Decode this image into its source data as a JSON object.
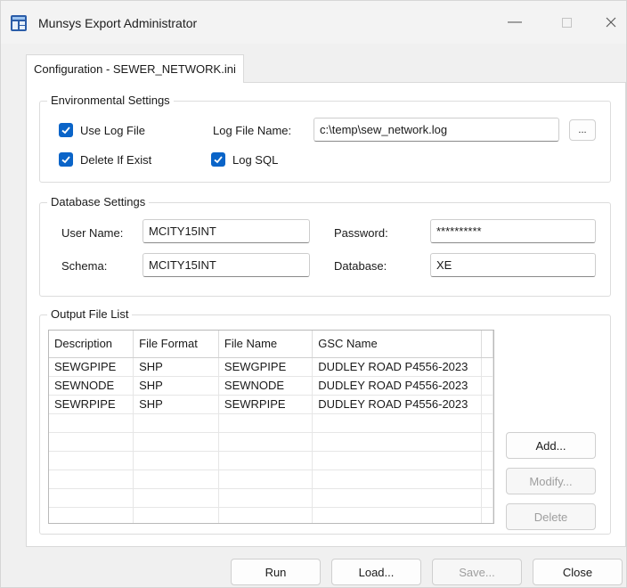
{
  "window": {
    "title": "Munsys Export Administrator"
  },
  "tab": {
    "label": "Configuration - SEWER_NETWORK.ini"
  },
  "environmental": {
    "legend": "Environmental Settings",
    "use_log_file": {
      "label": "Use Log File",
      "checked": true
    },
    "delete_if_exist": {
      "label": "Delete If Exist",
      "checked": true
    },
    "log_sql": {
      "label": "Log SQL",
      "checked": true
    },
    "log_file_name_label": "Log File Name:",
    "log_file_name_value": "c:\\temp\\sew_network.log",
    "browse_label": "..."
  },
  "database": {
    "legend": "Database Settings",
    "user_name_label": "User Name:",
    "user_name_value": "MCITY15INT",
    "password_label": "Password:",
    "password_value": "**********",
    "schema_label": "Schema:",
    "schema_value": "MCITY15INT",
    "database_label": "Database:",
    "database_value": "XE"
  },
  "output": {
    "legend": "Output File List",
    "columns": [
      "Description",
      "File Format",
      "File Name",
      "GSC Name"
    ],
    "rows": [
      [
        "SEWGPIPE",
        "SHP",
        "SEWGPIPE",
        "DUDLEY ROAD P4556-2023"
      ],
      [
        "SEWNODE",
        "SHP",
        "SEWNODE",
        "DUDLEY ROAD P4556-2023"
      ],
      [
        "SEWRPIPE",
        "SHP",
        "SEWRPIPE",
        "DUDLEY ROAD P4556-2023"
      ]
    ],
    "add_label": "Add...",
    "modify_label": "Modify...",
    "delete_label": "Delete"
  },
  "footer": {
    "run_label": "Run",
    "load_label": "Load...",
    "save_label": "Save...",
    "close_label": "Close"
  },
  "colors": {
    "accent": "#0a64c8"
  },
  "icons": {
    "app": "app-window-icon",
    "check": "check-icon",
    "minimize": "minimize-icon",
    "maximize": "maximize-icon",
    "close": "close-icon"
  }
}
